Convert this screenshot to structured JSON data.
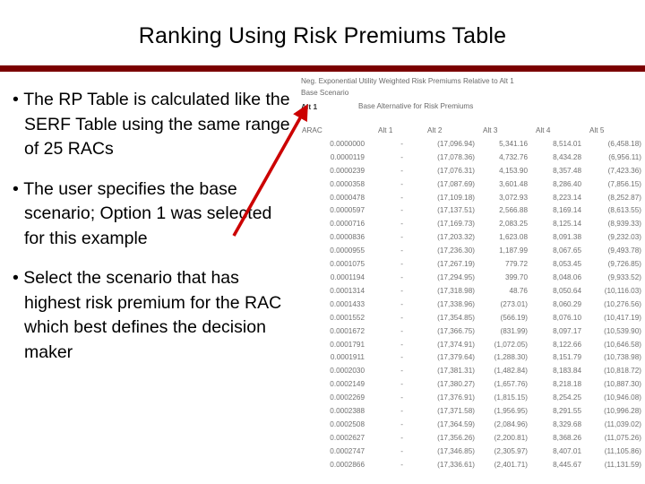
{
  "slide": {
    "title": "Ranking Using Risk Premiums Table",
    "divider_color": "#7B0000",
    "arrow_color": "#CC0000"
  },
  "bullets": [
    "The RP Table is calculated like the SERF Table using the same range of 25 RACs",
    "The user specifies the base scenario; Option 1 was selected for this example",
    "Select the scenario that has highest risk premium for the RAC which best defines the decision maker"
  ],
  "sheet": {
    "note_title": "Neg. Exponential Utility Weighted Risk Premiums Relative to Alt 1",
    "note_base": "Base Scenario",
    "alt1_label": "Alt 1",
    "alt1_description": "Base Alternative for Risk Premiums",
    "columns": [
      "ARAC",
      "Alt 1",
      "Alt 2",
      "Alt 3",
      "Alt 4",
      "Alt 5"
    ],
    "rows": [
      [
        "0.0000000",
        "-",
        "(17,096.94)",
        "5,341.16",
        "8,514.01",
        "(6,458.18)"
      ],
      [
        "0.0000119",
        "-",
        "(17,078.36)",
        "4,732.76",
        "8,434.28",
        "(6,956.11)"
      ],
      [
        "0.0000239",
        "-",
        "(17,076.31)",
        "4,153.90",
        "8,357.48",
        "(7,423.36)"
      ],
      [
        "0.0000358",
        "-",
        "(17,087.69)",
        "3,601.48",
        "8,286.40",
        "(7,856.15)"
      ],
      [
        "0.0000478",
        "-",
        "(17,109.18)",
        "3,072.93",
        "8,223.14",
        "(8,252.87)"
      ],
      [
        "0.0000597",
        "-",
        "(17,137.51)",
        "2,566.88",
        "8,169.14",
        "(8,613.55)"
      ],
      [
        "0.0000716",
        "-",
        "(17,169.73)",
        "2,083.25",
        "8,125.14",
        "(8,939.33)"
      ],
      [
        "0.0000836",
        "-",
        "(17,203.32)",
        "1,623.08",
        "8,091.38",
        "(9,232.03)"
      ],
      [
        "0.0000955",
        "-",
        "(17,236.30)",
        "1,187.99",
        "8,067.65",
        "(9,493.78)"
      ],
      [
        "0.0001075",
        "-",
        "(17,267.19)",
        "779.72",
        "8,053.45",
        "(9,726.85)"
      ],
      [
        "0.0001194",
        "-",
        "(17,294.95)",
        "399.70",
        "8,048.06",
        "(9,933.52)"
      ],
      [
        "0.0001314",
        "-",
        "(17,318.98)",
        "48.76",
        "8,050.64",
        "(10,116.03)"
      ],
      [
        "0.0001433",
        "-",
        "(17,338.96)",
        "(273.01)",
        "8,060.29",
        "(10,276.56)"
      ],
      [
        "0.0001552",
        "-",
        "(17,354.85)",
        "(566.19)",
        "8,076.10",
        "(10,417.19)"
      ],
      [
        "0.0001672",
        "-",
        "(17,366.75)",
        "(831.99)",
        "8,097.17",
        "(10,539.90)"
      ],
      [
        "0.0001791",
        "-",
        "(17,374.91)",
        "(1,072.05)",
        "8,122.66",
        "(10,646.58)"
      ],
      [
        "0.0001911",
        "-",
        "(17,379.64)",
        "(1,288.30)",
        "8,151.79",
        "(10,738.98)"
      ],
      [
        "0.0002030",
        "-",
        "(17,381.31)",
        "(1,482.84)",
        "8,183.84",
        "(10,818.72)"
      ],
      [
        "0.0002149",
        "-",
        "(17,380.27)",
        "(1,657.76)",
        "8,218.18",
        "(10,887.30)"
      ],
      [
        "0.0002269",
        "-",
        "(17,376.91)",
        "(1,815.15)",
        "8,254.25",
        "(10,946.08)"
      ],
      [
        "0.0002388",
        "-",
        "(17,371.58)",
        "(1,956.95)",
        "8,291.55",
        "(10,996.28)"
      ],
      [
        "0.0002508",
        "-",
        "(17,364.59)",
        "(2,084.96)",
        "8,329.68",
        "(11,039.02)"
      ],
      [
        "0.0002627",
        "-",
        "(17,356.26)",
        "(2,200.81)",
        "8,368.26",
        "(11,075.26)"
      ],
      [
        "0.0002747",
        "-",
        "(17,346.85)",
        "(2,305.97)",
        "8,407.01",
        "(11,105.86)"
      ],
      [
        "0.0002866",
        "-",
        "(17,336.61)",
        "(2,401.71)",
        "8,445.67",
        "(11,131.59)"
      ]
    ]
  }
}
